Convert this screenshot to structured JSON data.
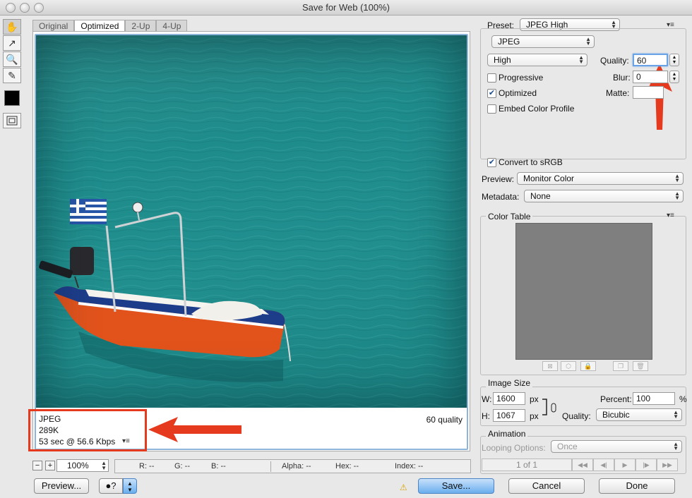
{
  "window": {
    "title": "Save for Web (100%)"
  },
  "tabs": [
    "Original",
    "Optimized",
    "2-Up",
    "4-Up"
  ],
  "tools": [
    {
      "icon": "hand-icon",
      "glyph": "✋"
    },
    {
      "icon": "slice-select-icon",
      "glyph": "↗"
    },
    {
      "icon": "zoom-icon",
      "glyph": "🔍"
    },
    {
      "icon": "eyedropper-icon",
      "glyph": "✎"
    }
  ],
  "info": {
    "format": "JPEG",
    "size": "289K",
    "download_time": "53 sec @ 56.6 Kbps",
    "quality_label": "60 quality"
  },
  "statusbar": {
    "zoom": "100%",
    "r": "R: --",
    "g": "G: --",
    "b": "B: --",
    "alpha": "Alpha: --",
    "hex": "Hex: --",
    "index": "Index: --"
  },
  "buttons": {
    "preview": "Preview...",
    "save": "Save...",
    "cancel": "Cancel",
    "done": "Done"
  },
  "settings": {
    "preset_label": "Preset:",
    "preset_value": "JPEG High",
    "format": "JPEG",
    "compression": "High",
    "quality_label": "Quality:",
    "quality_value": "60",
    "progressive_label": "Progressive",
    "progressive": false,
    "blur_label": "Blur:",
    "blur_value": "0",
    "optimized_label": "Optimized",
    "optimized": true,
    "matte_label": "Matte:",
    "embed_label": "Embed Color Profile",
    "embed": false,
    "srgb_label": "Convert to sRGB",
    "srgb": true,
    "preview_label": "Preview:",
    "preview_value": "Monitor Color",
    "metadata_label": "Metadata:",
    "metadata_value": "None"
  },
  "color_table": {
    "title": "Color Table"
  },
  "image_size": {
    "title": "Image Size",
    "w_label": "W:",
    "w_value": "1600",
    "h_label": "H:",
    "h_value": "1067",
    "unit": "px",
    "percent_label": "Percent:",
    "percent_value": "100",
    "percent_unit": "%",
    "quality_label": "Quality:",
    "quality_value": "Bicubic"
  },
  "animation": {
    "title": "Animation",
    "looping_label": "Looping Options:",
    "looping_value": "Once",
    "frame": "1 of 1"
  },
  "colors": {
    "annotation_red": "#e63a1e",
    "focus_blue": "#6aa4e6",
    "save_button": "#6aaeee",
    "water": "#1f8c8c"
  }
}
